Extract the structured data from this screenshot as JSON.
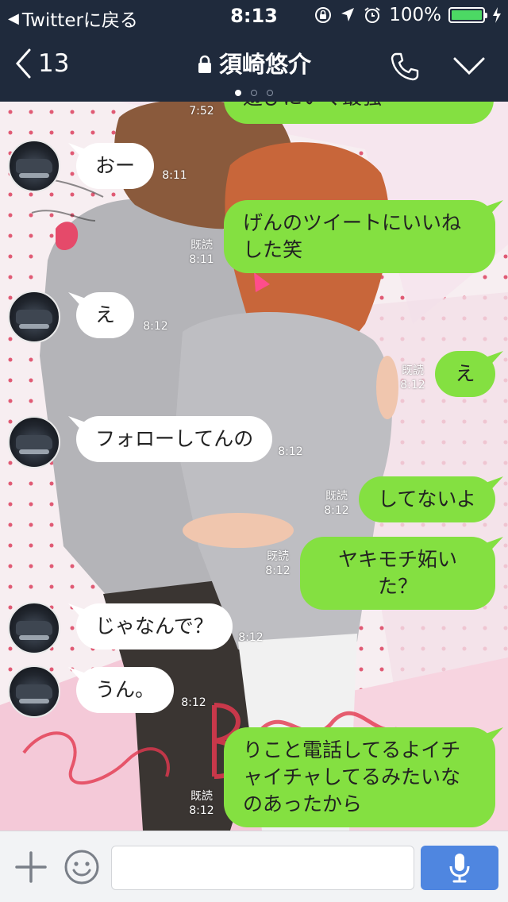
{
  "status_bar": {
    "back_app": "Twitterに戻る",
    "time": "8:13",
    "battery": "100%",
    "battery_level": 1.0,
    "battery_color": "#4cd964"
  },
  "nav": {
    "back_count": "13",
    "title": "須崎悠介",
    "page_dots": 3,
    "active_dot": 0,
    "icons": [
      "back-chevron-icon",
      "lock-icon",
      "phone-icon",
      "chevron-down-icon"
    ]
  },
  "messages": [
    {
      "side": "out",
      "text": "遊びにいく最強",
      "time": "7:52",
      "read": ""
    },
    {
      "side": "in",
      "text": "おー",
      "time": "8:11"
    },
    {
      "side": "out",
      "text": "げんのツイートにいいねした笑",
      "time": "8:11",
      "read": "既読"
    },
    {
      "side": "in",
      "text": "え",
      "time": "8:12"
    },
    {
      "side": "out",
      "text": "え",
      "time": "8:12",
      "read": "既読"
    },
    {
      "side": "in",
      "text": "フォローしてんの",
      "time": "8:12"
    },
    {
      "side": "out",
      "text": "してないよ",
      "time": "8:12",
      "read": "既読"
    },
    {
      "side": "out",
      "text": "ヤキモチ妬いた？",
      "time": "8:12",
      "read": "既読"
    },
    {
      "side": "in",
      "text": "じゃなんで？",
      "time": "8:12"
    },
    {
      "side": "in",
      "text": "うん。",
      "time": "8:12"
    },
    {
      "side": "out",
      "text": "りこと電話してるよイチャイチャしてるみたいなのあったから",
      "time": "8:12",
      "read": "既読"
    }
  ],
  "input_bar": {
    "placeholder": "",
    "icons": [
      "plus-icon",
      "emoji-icon",
      "mic-icon"
    ],
    "mic_color": "#4f86e0"
  },
  "colors": {
    "header": "#1f2a3c",
    "outgoing_bubble": "#84e041",
    "incoming_bubble": "#ffffff"
  }
}
